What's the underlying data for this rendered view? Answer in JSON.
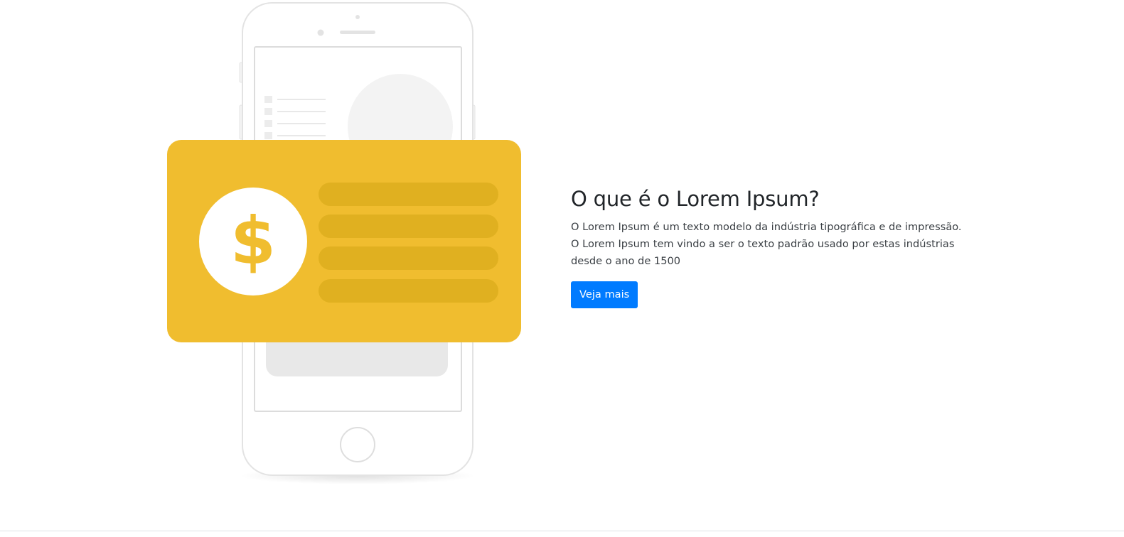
{
  "hero": {
    "heading": "O que é o Lorem Ipsum?",
    "description": "O Lorem Ipsum é um texto modelo da indústria tipográfica e de impressão. O Lorem Ipsum tem vindo a ser o texto padrão usado por estas indústrias desde o ano de 1500",
    "button_label": "Veja mais"
  },
  "illustration": {
    "card_symbol": "$",
    "icons": [
      "phone-illustration",
      "payment-card-illustration",
      "dollar-coin-icon"
    ]
  },
  "colors": {
    "card": "#f0bd2f",
    "card_lines": "#e0b020",
    "accent": "#007bff",
    "heading": "#212529"
  }
}
